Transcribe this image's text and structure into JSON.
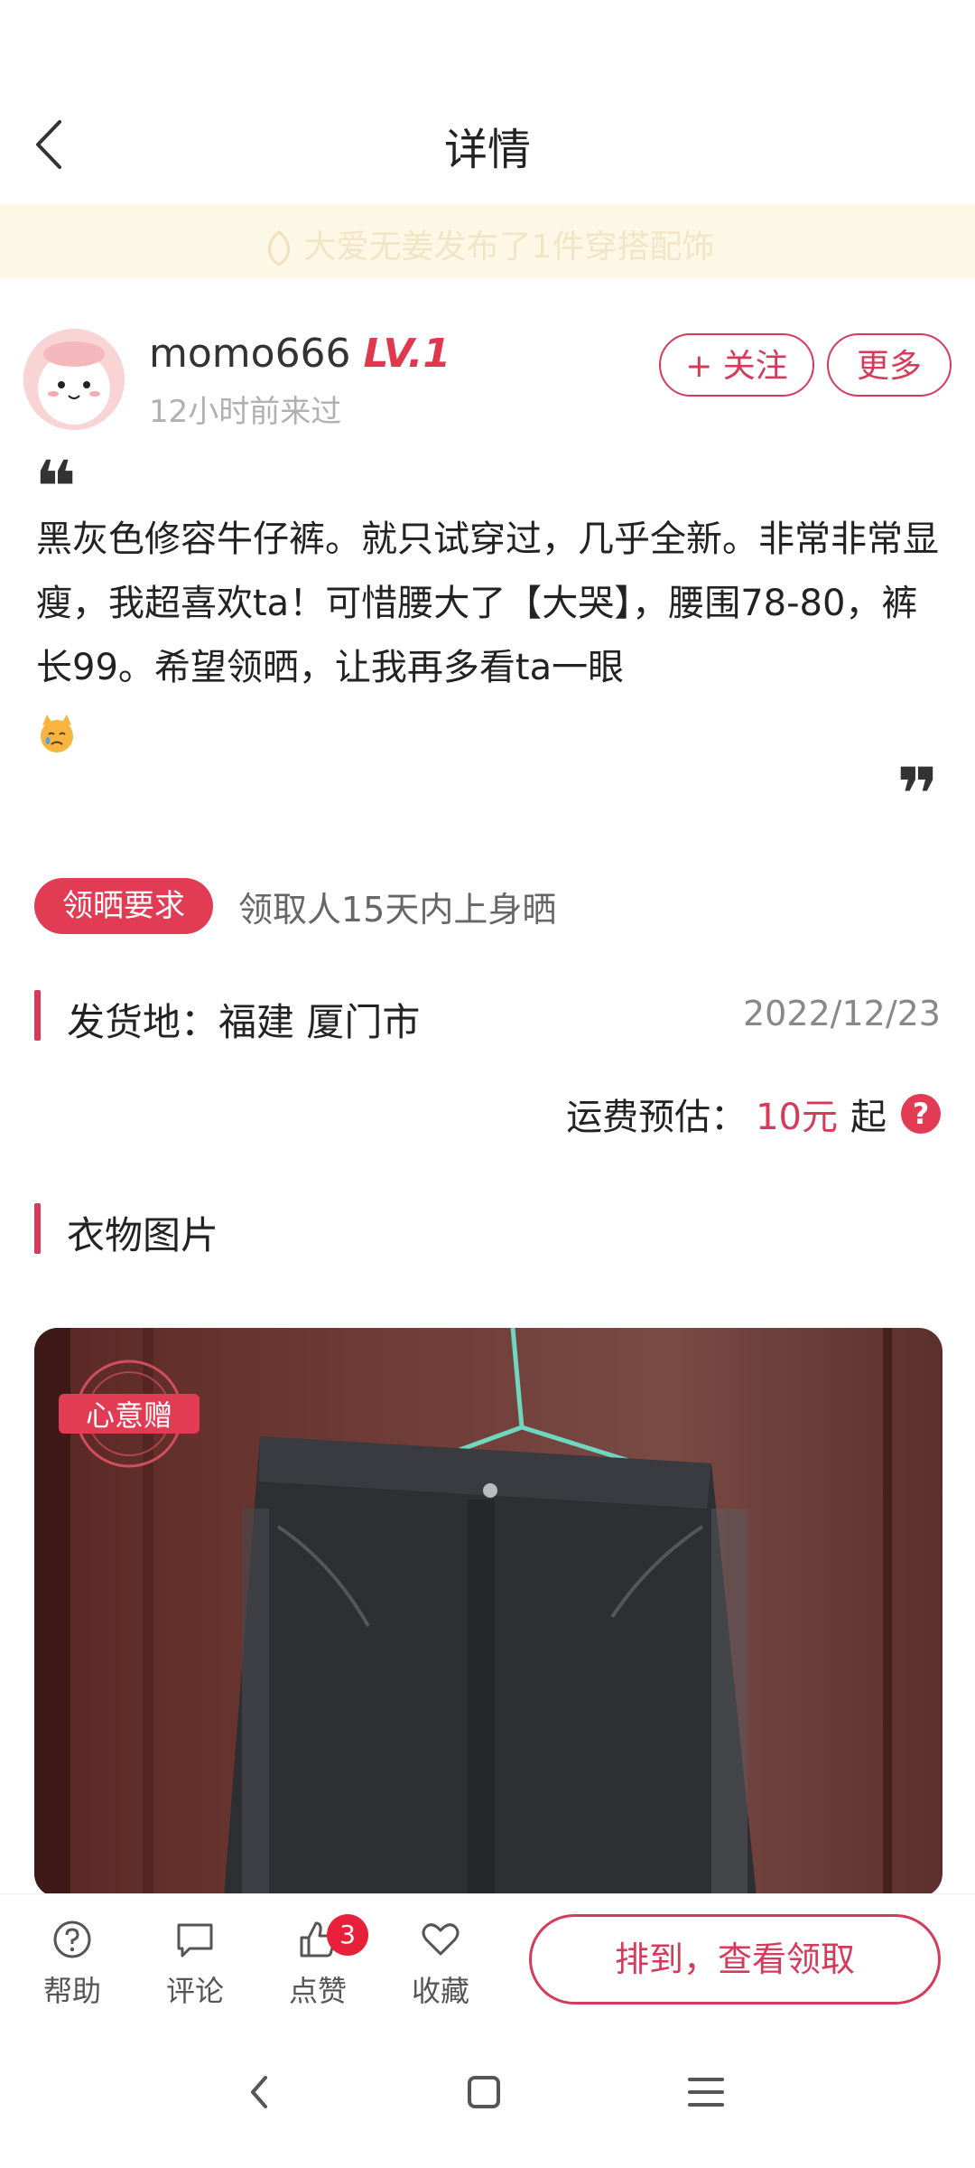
{
  "header": {
    "title": "详情",
    "back_icon": "chevron-left-icon"
  },
  "banner": {
    "text": "大爱无姜发布了1件穿搭配饰",
    "icon": "leaf-icon"
  },
  "user": {
    "name": "momo666",
    "level": "LV.1",
    "last_seen": "12小时前来过",
    "follow_label": "+ 关注",
    "more_label": "更多"
  },
  "post": {
    "quote_open": "❝",
    "quote_close": "❞",
    "description": "黑灰色修容牛仔裤。就只试穿过，几乎全新。非常非常显瘦，我超喜欢ta！可惜腰大了【大哭】，腰围78-80，裤长99。希望领晒，让我再多看ta一眼",
    "emoji": "crying-cat-emoji"
  },
  "requirement": {
    "badge": "领晒要求",
    "text": "领取人15天内上身晒"
  },
  "shipping": {
    "label": "发货地：福建 厦门市",
    "date": "2022/12/23",
    "fee_label": "运费预估：",
    "fee_value": "10元",
    "fee_suffix": "起",
    "help_mark": "?"
  },
  "photos": {
    "section_label": "衣物图片",
    "stamp_text": "心意赠"
  },
  "bottom_bar": {
    "help_label": "帮助",
    "comment_label": "评论",
    "like_label": "点赞",
    "like_count": "3",
    "favorite_label": "收藏",
    "claim_label": "排到，查看领取"
  },
  "colors": {
    "accent": "#d63a5a",
    "banner_bg": "#fdf8e6"
  }
}
